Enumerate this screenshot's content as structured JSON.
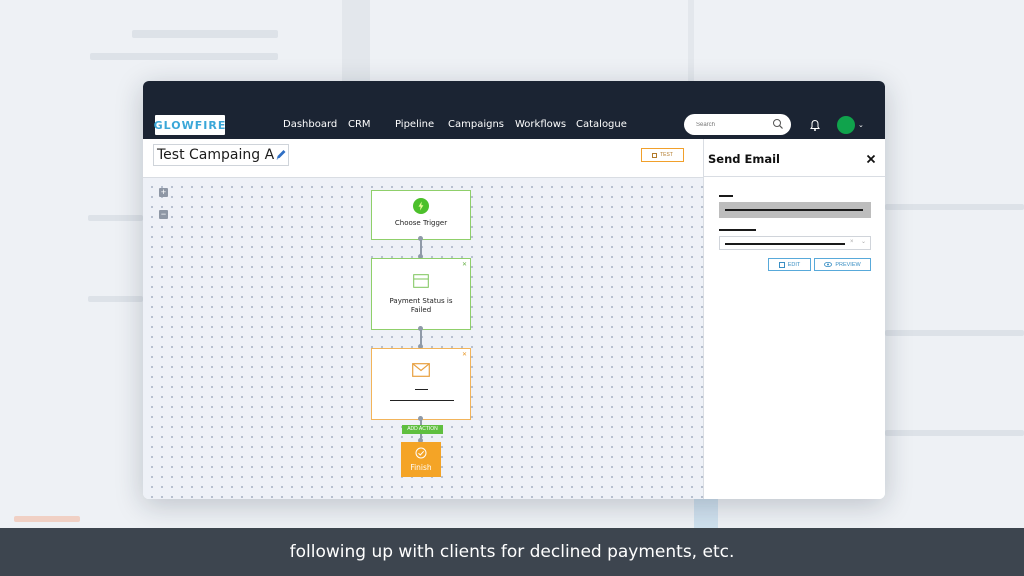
{
  "app": {
    "logo_text": "GLOWFIRE"
  },
  "nav": {
    "items": [
      "Dashboard",
      "CRM",
      "Pipeline",
      "Campaigns",
      "Workflows",
      "Catalogue"
    ],
    "search_placeholder": "Search"
  },
  "campaign": {
    "title": "Test Campaing A",
    "test_label": "TEST"
  },
  "canvas": {
    "zoom_in": "+",
    "zoom_out": "−",
    "nodes": {
      "trigger_label": "Choose Trigger",
      "condition_label": "Payment Status is Failed",
      "add_action_label": "ADD ACTION",
      "finish_label": "Finish"
    }
  },
  "panel": {
    "title": "Send Email",
    "edit_label": "EDIT",
    "preview_label": "PREVIEW"
  },
  "caption": {
    "text": "following up with clients for declined payments, etc."
  },
  "colors": {
    "navbar": "#1b2433",
    "trigger_border": "#8fcf6a",
    "action_border": "#f2b45a",
    "finish": "#f4a426",
    "add_action": "#5fbf3f",
    "panel_button": "#58a9da",
    "avatar": "#10a34c"
  }
}
